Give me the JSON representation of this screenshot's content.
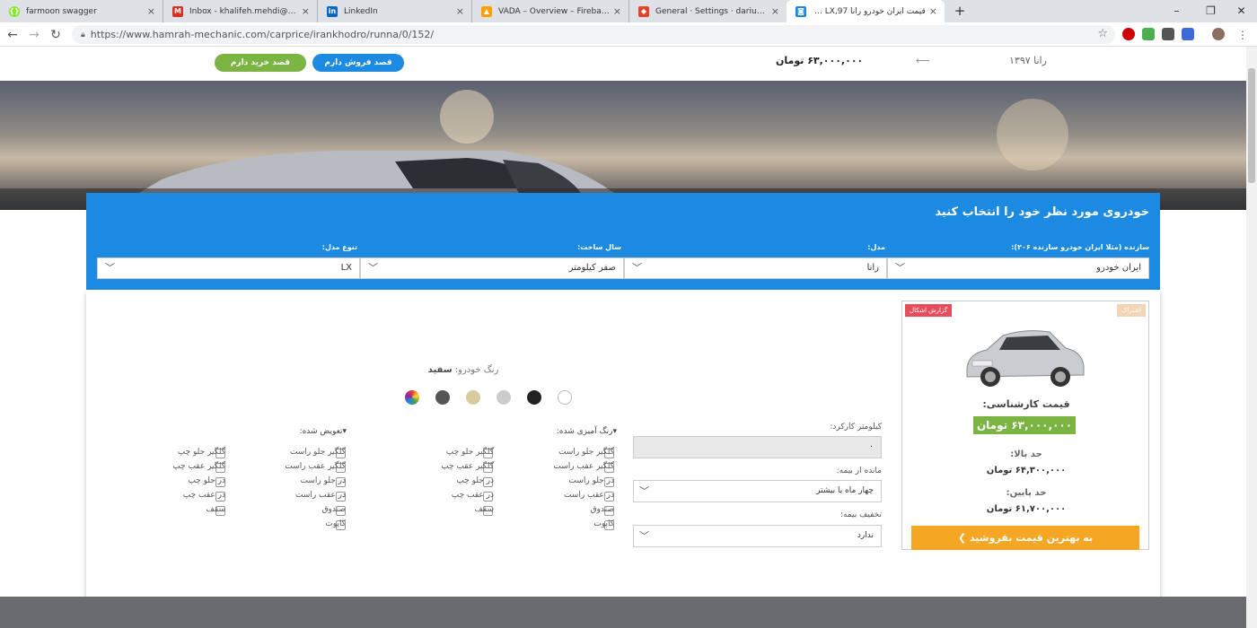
{
  "browser": {
    "tabs": [
      {
        "label": "farmoon swagger",
        "icon": "swagger-icon",
        "color": "#85ea2d"
      },
      {
        "label": "Inbox - khalifeh.mehdi@gmail.com",
        "icon": "gmail-icon",
        "color": "#d93025"
      },
      {
        "label": "LinkedIn",
        "icon": "linkedin-icon",
        "color": "#0a66c2"
      },
      {
        "label": "VADA – Overview – Firebase console",
        "icon": "firebase-icon",
        "color": "#ffa000"
      },
      {
        "label": "General · Settings · dariush / vhe",
        "icon": "gitlab-icon",
        "color": "#e24329"
      },
      {
        "label": "قیمت ایران خودرو رانا LX,97 - همراه",
        "icon": "site-icon",
        "color": "#1c8ae0"
      }
    ],
    "new_tab_label": "+",
    "window_controls": {
      "minimize": "–",
      "restore": "❐",
      "close": "✕"
    },
    "url": "https://www.hamrah-mechanic.com/carprice/irankhodro/runna/0/152/"
  },
  "topbar": {
    "buy_button": "قصد خرید دارم",
    "sell_button": "قصد فروش دارم",
    "price": "۶۳,۰۰۰,۰۰۰ تومان",
    "arrow": "⟵",
    "car_year": "رانا ۱۳۹۷"
  },
  "form": {
    "title": "خودروی مورد نظر خود را انتخاب کنید",
    "fields": [
      {
        "label": "سازنده (مثلا ایران خودرو سازنده ۲۰۶):",
        "value": "ایران خودرو"
      },
      {
        "label": "مدل:",
        "value": "رانا"
      },
      {
        "label": "سال ساخت:",
        "value": "صفر کیلومتر"
      },
      {
        "label": "تنوع مدل:",
        "value": "LX"
      }
    ]
  },
  "card": {
    "share": "اشتراک",
    "report": "گزارش اشکال",
    "expert_price_label": "قیمت کارشناسی:",
    "expert_price": "۶۳,۰۰۰,۰۰۰ تومان",
    "max_label": "حد بالا:",
    "max_value": "۶۴,۳۰۰,۰۰۰ تومان",
    "min_label": "حد پایین:",
    "min_value": "۶۱,۷۰۰,۰۰۰ تومان",
    "sell_button": "به بهترین قیمت بفروشید ❯"
  },
  "details": {
    "km_label": "کیلومتر کارکرد:",
    "km_value": "۰",
    "insurance_label": "مانده از بیمه:",
    "insurance_value": "چهار ماه یا بیشتر",
    "discount_label": "تخفیف بیمه:",
    "discount_value": "ندارد",
    "color_label": "رنگ خودرو:",
    "color_value": "سفید",
    "swatch_colors": [
      "#ffffff",
      "#222222",
      "#cccccc",
      "#d9cba0",
      "#555555",
      "multicolor"
    ]
  },
  "painted": {
    "header": "رنگ آمیزی شده:",
    "right_col": [
      "گلگیر جلو راست",
      "گلگیر عقب راست",
      "در جلو راست",
      "در عقب راست",
      "صندوق",
      "کاپوت"
    ],
    "left_col": [
      "گلگیر جلو چپ",
      "گلگیر عقب چپ",
      "در جلو چپ",
      "در عقب چپ",
      "سقف"
    ]
  },
  "replaced": {
    "header": "تعویض شده:",
    "right_col": [
      "گلگیر جلو راست",
      "گلگیر عقب راست",
      "در جلو راست",
      "در عقب راست",
      "صندوق",
      "کاپوت"
    ],
    "left_col": [
      "گلگیر جلو چپ",
      "گلگیر عقب چپ",
      "در جلو چپ",
      "در عقب چپ",
      "سقف"
    ]
  }
}
